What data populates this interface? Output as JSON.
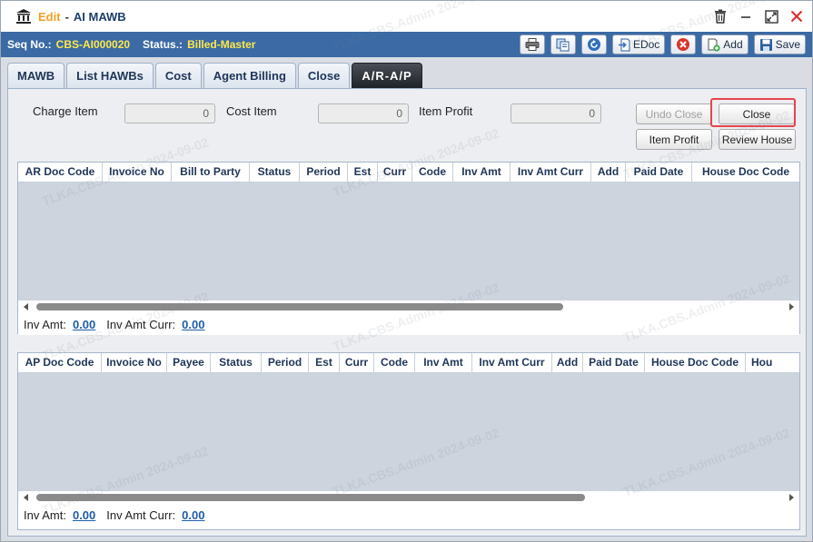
{
  "window": {
    "mode": "Edit",
    "separator": "-",
    "title": "AI MAWB"
  },
  "infobar": {
    "seq_label": "Seq No.:",
    "seq_value": "CBS-AI000020",
    "status_label": "Status.:",
    "status_value": "Billed-Master"
  },
  "toolbar": {
    "print_icon": "printer-icon",
    "copy_icon": "copy-icon",
    "refresh_icon": "refresh-icon",
    "edoc_label": "EDoc",
    "cancel_icon": "cancel-icon",
    "add_label": "Add",
    "save_label": "Save"
  },
  "tabs": [
    {
      "label": "MAWB"
    },
    {
      "label": "List HAWBs"
    },
    {
      "label": "Cost"
    },
    {
      "label": "Agent Billing"
    },
    {
      "label": "Close"
    },
    {
      "label": "A/R-A/P",
      "active": true
    }
  ],
  "summary": {
    "charge_item_label": "Charge Item",
    "charge_item_value": "0",
    "cost_item_label": "Cost Item",
    "cost_item_value": "0",
    "item_profit_label": "Item Profit",
    "item_profit_value": "0"
  },
  "actions": {
    "undo_close": "Undo Close",
    "close": "Close",
    "item_profit": "Item Profit",
    "review_house": "Review House"
  },
  "ar_grid": {
    "columns": [
      "AR Doc Code",
      "Invoice No",
      "Bill to Party",
      "Status",
      "Period",
      "Est",
      "Curr",
      "Code",
      "Inv Amt",
      "Inv Amt Curr",
      "Add",
      "Paid Date",
      "House Doc Code"
    ],
    "rows": [],
    "footer": {
      "inv_amt_label": "Inv Amt:",
      "inv_amt_value": "0.00",
      "inv_amt_curr_label": "Inv Amt Curr:",
      "inv_amt_curr_value": "0.00"
    }
  },
  "ap_grid": {
    "columns": [
      "AP Doc Code",
      "Invoice No",
      "Payee",
      "Status",
      "Period",
      "Est",
      "Curr",
      "Code",
      "Inv Amt",
      "Inv Amt Curr",
      "Add",
      "Paid Date",
      "House Doc Code",
      "Hou"
    ],
    "rows": [],
    "footer": {
      "inv_amt_label": "Inv Amt:",
      "inv_amt_value": "0.00",
      "inv_amt_curr_label": "Inv Amt Curr:",
      "inv_amt_curr_value": "0.00"
    }
  },
  "watermark": "TLKA.CBS.Admin 2024-09-02",
  "colors": {
    "infobar_bg": "#3b6aa5",
    "highlight_value": "#ffe84a",
    "mode_text": "#f0a020",
    "link_value": "#1e5ea8",
    "focus_outline": "#e8434d"
  }
}
